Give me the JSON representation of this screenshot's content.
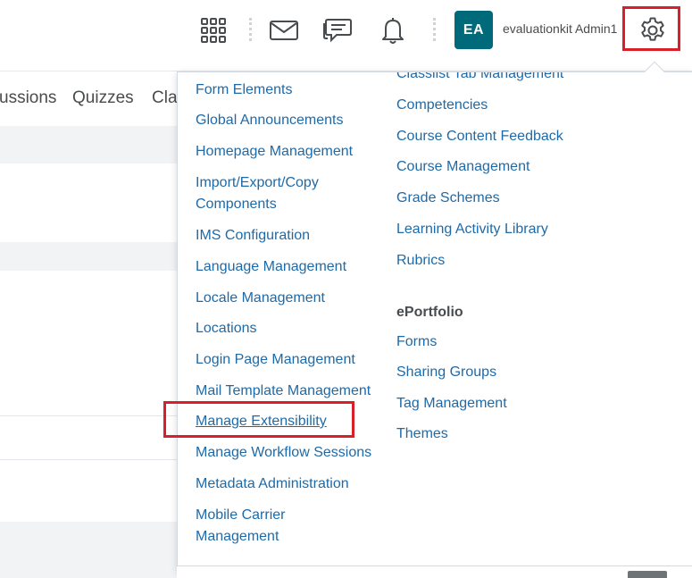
{
  "header": {
    "avatar_initials": "EA",
    "user_name": "evaluationkit Admin1",
    "icons": [
      "grid-icon",
      "mail-icon",
      "chat-icon",
      "bell-icon",
      "gear-icon"
    ],
    "highlight_color": "#d9202a",
    "avatar_color": "#006a7a"
  },
  "navbar": {
    "items": [
      "ussions",
      "Quizzes",
      "Cla"
    ]
  },
  "dropdown": {
    "left_column": [
      "Form Elements",
      "Global Announcements",
      "Homepage Management",
      "Import/Export/Copy",
      "Components",
      "IMS Configuration",
      "Language Management",
      "Locale Management",
      "Locations",
      "Login Page Management",
      "Mail Template Management",
      "Manage Extensibility",
      "Manage Workflow Sessions",
      "Metadata Administration",
      "Mobile Carrier",
      "Management"
    ],
    "right_column_top_cut": "Classlist Tab Management",
    "right_column": [
      "Competencies",
      "Course Content Feedback",
      "Course Management",
      "Grade Schemes",
      "Learning Activity Library",
      "Rubrics"
    ],
    "eportfolio_heading": "ePortfolio",
    "eportfolio_items": [
      "Forms",
      "Sharing Groups",
      "Tag Management",
      "Themes"
    ],
    "link_color": "#1e6aa8"
  }
}
